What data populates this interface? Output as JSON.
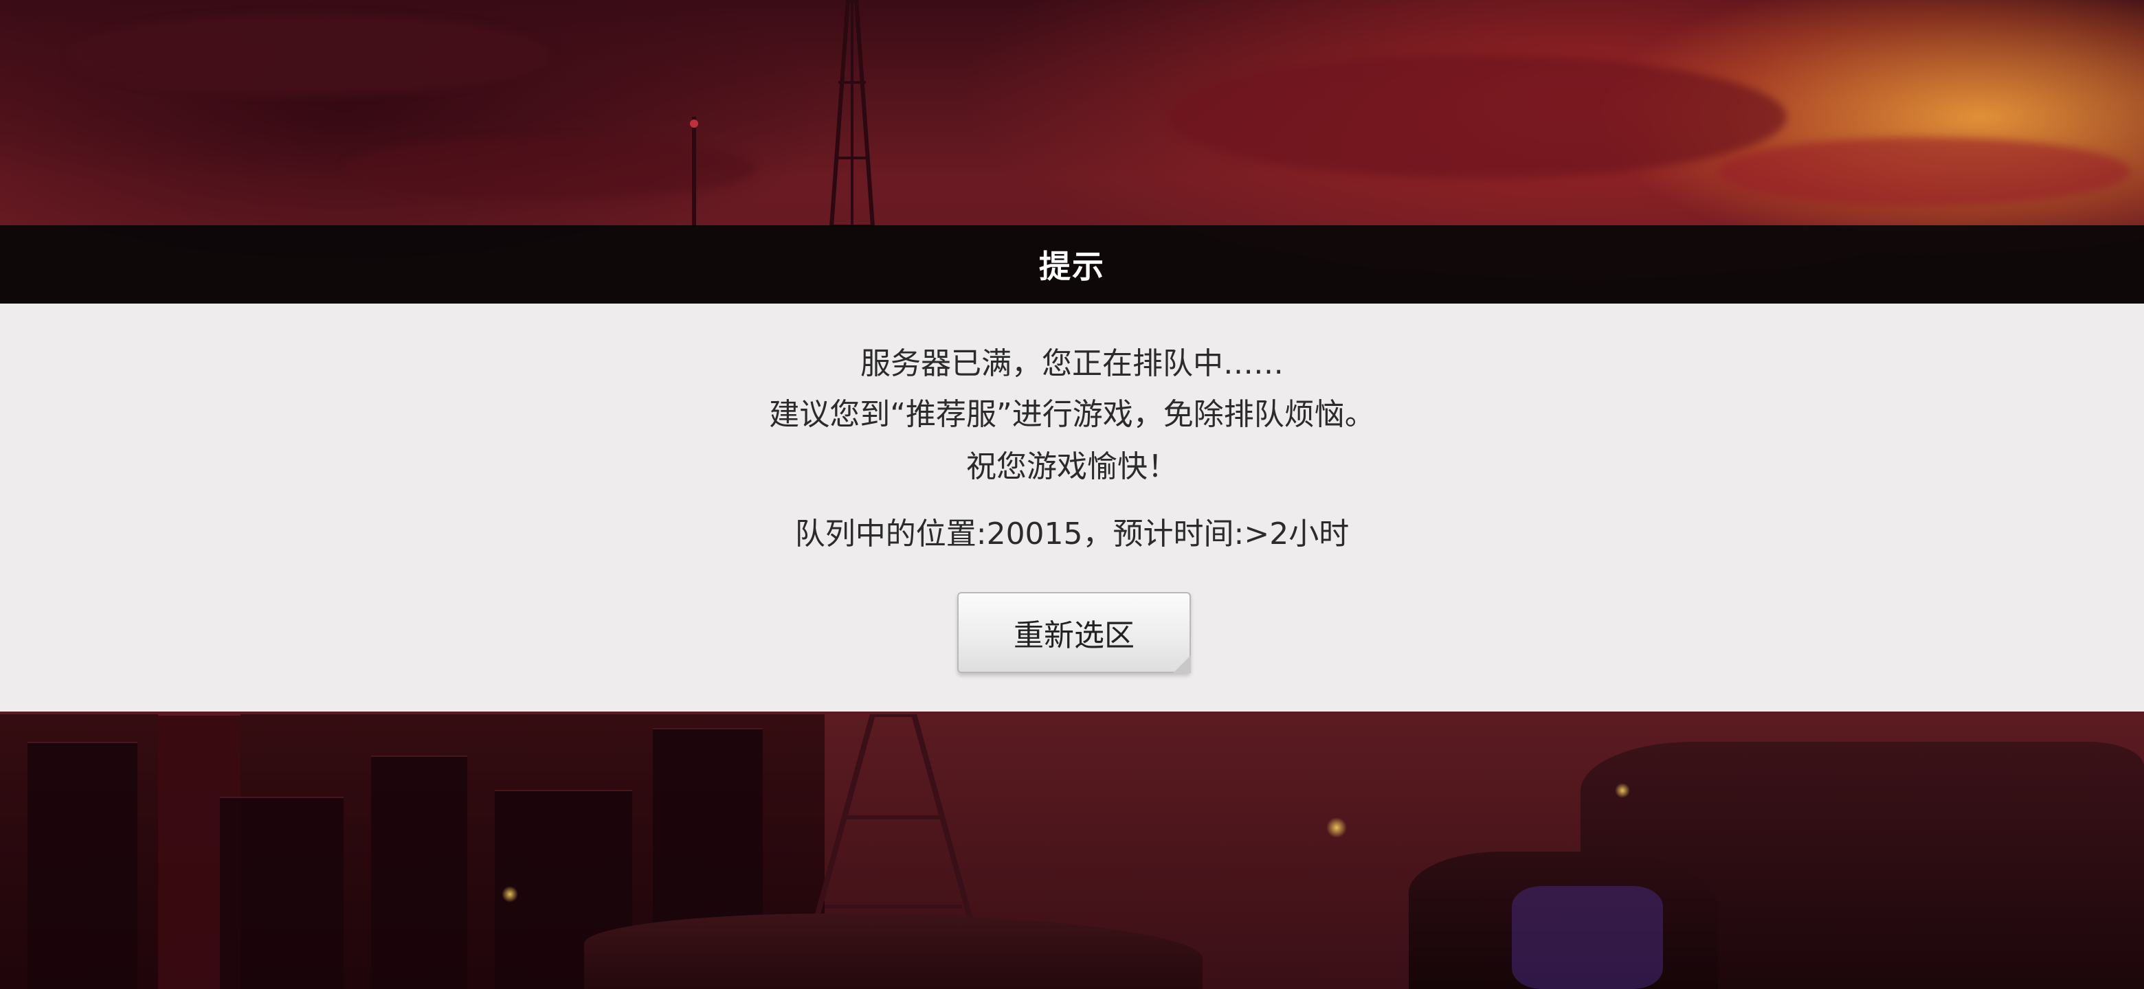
{
  "dialog": {
    "title": "提示",
    "line1": "服务器已满，您正在排队中……",
    "line2": "建议您到“推荐服”进行游戏，免除排队烦恼。",
    "line3": "祝您游戏愉快！",
    "queue_info": "队列中的位置:20015，预计时间:>2小时",
    "button_label": "重新选区"
  },
  "colors": {
    "sky_dark": "#3a0c16",
    "sky_red": "#6a1a22",
    "sunset_orange": "#f5a53c",
    "title_bar": "#080608",
    "panel": "#f4f4f4",
    "text": "#2b2b2b"
  }
}
